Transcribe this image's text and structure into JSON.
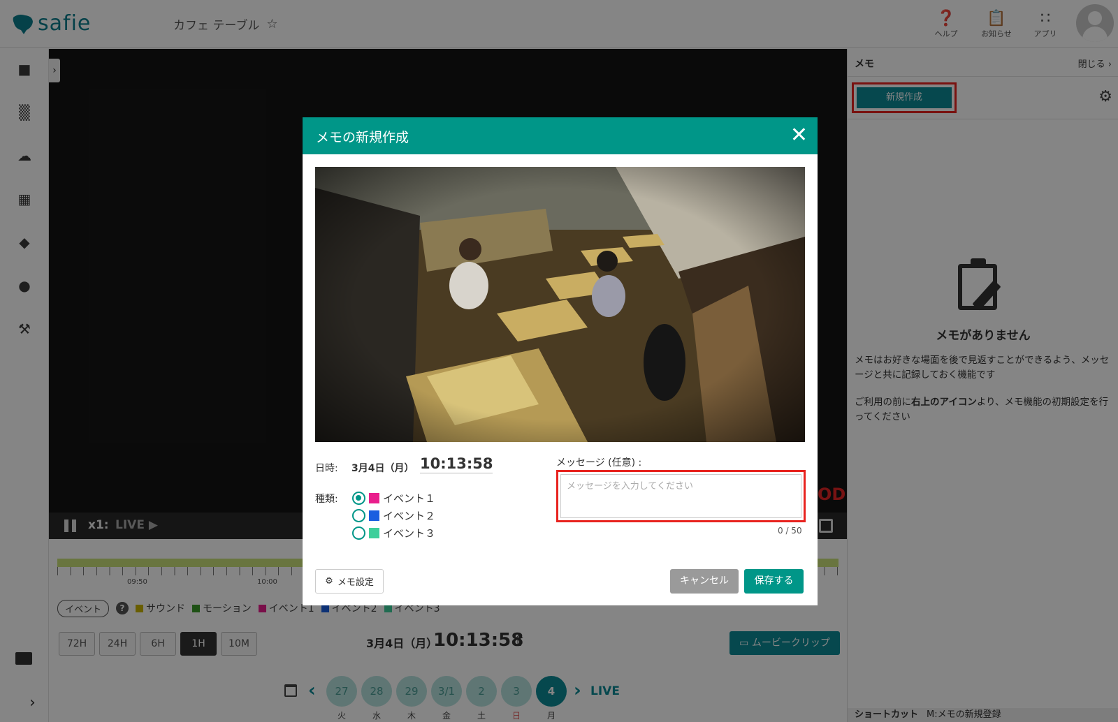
{
  "header": {
    "logo_text": "safie",
    "camera_title": "カフェ テーブル",
    "help_label": "ヘルプ",
    "notice_label": "お知らせ",
    "apps_label": "アプリ"
  },
  "player": {
    "speed": "x1:",
    "live": "LIVE ▶",
    "rec_partial": "OD"
  },
  "timeline": {
    "ticks": [
      "09:50",
      "10:00"
    ],
    "event_filter": "イベント",
    "legend": [
      {
        "name": "サウンド",
        "color": "#c9b400"
      },
      {
        "name": "モーション",
        "color": "#3a9c2a"
      },
      {
        "name": "イベント1",
        "color": "#e91e8c"
      },
      {
        "name": "イベント2",
        "color": "#1a5fe0"
      },
      {
        "name": "イベント3",
        "color": "#3ecf9b"
      }
    ],
    "ranges": [
      "72H",
      "24H",
      "6H",
      "1H",
      "10M"
    ],
    "active_range": "1H",
    "date": "3月4日（月）",
    "time": "10:13:58",
    "movie_clip": "ムービークリップ",
    "days": [
      {
        "num": "27",
        "wd": "火"
      },
      {
        "num": "28",
        "wd": "水"
      },
      {
        "num": "29",
        "wd": "木"
      },
      {
        "num": "3/1",
        "wd": "金"
      },
      {
        "num": "2",
        "wd": "土"
      },
      {
        "num": "3",
        "wd": "日"
      },
      {
        "num": "4",
        "wd": "月"
      }
    ],
    "live_link": "LIVE"
  },
  "memo_panel": {
    "title": "メモ",
    "close": "閉じる",
    "new_button": "新規作成",
    "empty_title": "メモがありません",
    "desc1": "メモはお好きな場面を後で見返すことができるよう、メッセージと共に記録しておく機能です",
    "desc2_a": "ご利用の前に",
    "desc2_b": "右上のアイコン",
    "desc2_c": "より、メモ機能の初期設定を行ってください",
    "shortcut_label": "ショートカット",
    "shortcut_text": "M:メモの新規登録"
  },
  "modal": {
    "title": "メモの新規作成",
    "datetime_label": "日時:",
    "date": "3月4日（月）",
    "time": "10:13:58",
    "kind_label": "種類:",
    "kinds": [
      {
        "label": "イベント１",
        "color": "#e91e8c",
        "selected": true
      },
      {
        "label": "イベント２",
        "color": "#1a5fe0",
        "selected": false
      },
      {
        "label": "イベント３",
        "color": "#3ecf9b",
        "selected": false
      }
    ],
    "message_label": "メッセージ (任意) :",
    "message_placeholder": "メッセージを入力してください",
    "message_value": "",
    "char_count": "0 / 50",
    "settings_button": "メモ設定",
    "cancel_button": "キャンセル",
    "save_button": "保存する"
  }
}
